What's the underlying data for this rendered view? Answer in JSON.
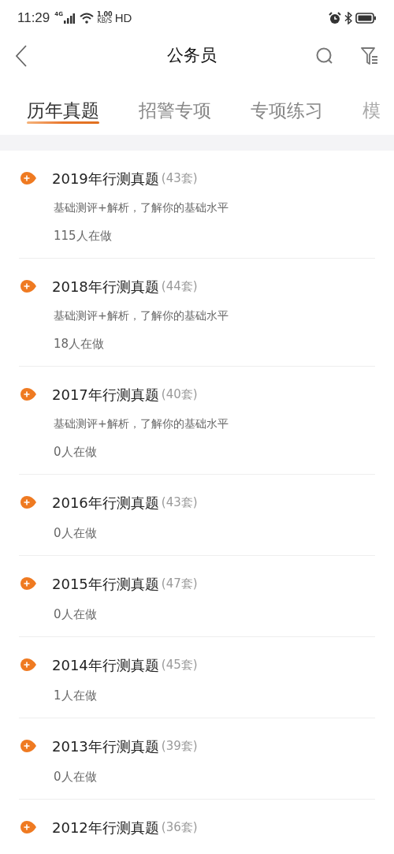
{
  "status_bar": {
    "time": "11:29",
    "network": "4G",
    "speed_value": "1.00",
    "speed_unit": "KB/S",
    "hd": "HD"
  },
  "header": {
    "title": "公务员"
  },
  "tabs": [
    {
      "label": "历年真题",
      "selected": true
    },
    {
      "label": "招警专项",
      "selected": false
    },
    {
      "label": "专项练习",
      "selected": false
    },
    {
      "label": "模",
      "selected": false,
      "faded": true
    }
  ],
  "items": [
    {
      "title": "2019年行测真题",
      "count": "(43套)",
      "description": "基础测评+解析，了解你的基础水平",
      "doing": "115人在做"
    },
    {
      "title": "2018年行测真题",
      "count": "(44套)",
      "description": "基础测评+解析，了解你的基础水平",
      "doing": "18人在做"
    },
    {
      "title": "2017年行测真题",
      "count": "(40套)",
      "description": "基础测评+解析，了解你的基础水平",
      "doing": "0人在做"
    },
    {
      "title": "2016年行测真题",
      "count": "(43套)",
      "doing": "0人在做"
    },
    {
      "title": "2015年行测真题",
      "count": "(47套)",
      "doing": "0人在做"
    },
    {
      "title": "2014年行测真题",
      "count": "(45套)",
      "doing": "1人在做"
    },
    {
      "title": "2013年行测真题",
      "count": "(39套)",
      "doing": "0人在做"
    },
    {
      "title": "2012年行测真题",
      "count": "(36套)"
    }
  ]
}
